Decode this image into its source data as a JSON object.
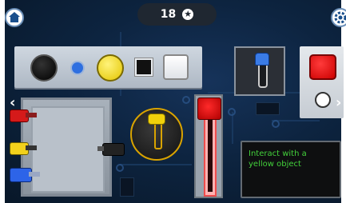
{
  "hud": {
    "score": "18",
    "score_icon": "star-icon",
    "home_icon": "home-icon",
    "settings_icon": "gear-icon"
  },
  "navigation": {
    "left_arrow": "‹",
    "right_arrow": "›"
  },
  "shelf_buttons": [
    {
      "name": "black-round-button",
      "color": "#000000"
    },
    {
      "name": "blue-small-button",
      "color": "#2e6fe0"
    },
    {
      "name": "yellow-round-button",
      "color": "#f0d000"
    },
    {
      "name": "black-square-button",
      "color": "#111111"
    },
    {
      "name": "white-square-button",
      "color": "#ffffff"
    }
  ],
  "controls": {
    "blue_slider_color": "#3a7be6",
    "yellow_dial_color": "#f1d10b",
    "red_slider_color": "#e00000",
    "right_panel_red_button": "#e00000",
    "right_panel_white_button": "#ffffff"
  },
  "plugs": [
    {
      "name": "red-plug",
      "color": "#d51a1a"
    },
    {
      "name": "yellow-plug",
      "color": "#f2d11c"
    },
    {
      "name": "blue-plug",
      "color": "#2d64e8"
    },
    {
      "name": "black-plug",
      "color": "#222222"
    }
  ],
  "message": {
    "text": "Interact with a yellow object"
  }
}
